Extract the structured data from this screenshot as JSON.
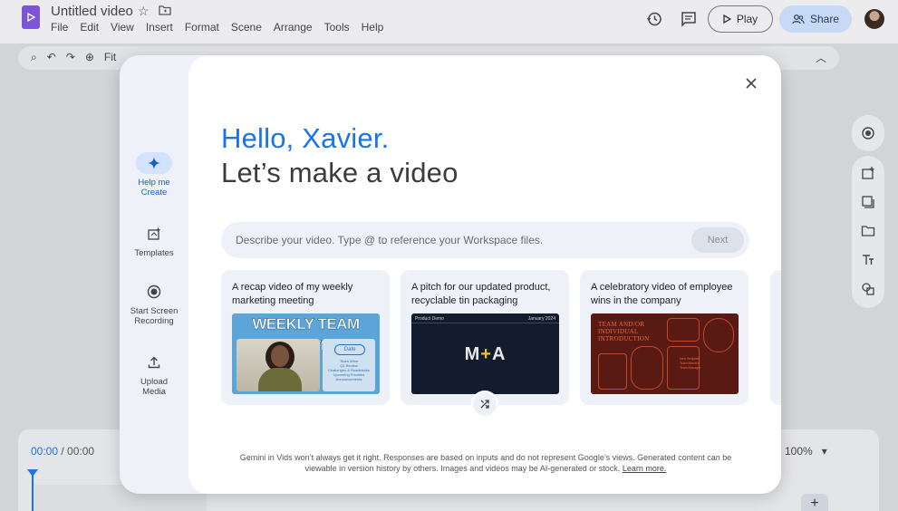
{
  "app": {
    "doc_title": "Untitled video",
    "menu": [
      "File",
      "Edit",
      "View",
      "Insert",
      "Format",
      "Scene",
      "Arrange",
      "Tools",
      "Help"
    ],
    "play_label": "Play",
    "share_label": "Share",
    "toolbar_fit_label": "Fit",
    "colors": {
      "brand_purple": "#7b55d6",
      "accent_blue": "#1a73e8",
      "share_bg": "#c7d9f4"
    }
  },
  "timeline": {
    "current_time": "00:00",
    "total_time": "/ 00:00",
    "zoom": "100%",
    "add_label": "+"
  },
  "modal": {
    "nav": [
      {
        "label_line1": "Help me",
        "label_line2": "Create",
        "icon": "sparkle-icon",
        "active": true
      },
      {
        "label_line1": "Templates",
        "label_line2": "",
        "icon": "templates-icon",
        "active": false
      },
      {
        "label_line1": "Start Screen",
        "label_line2": "Recording",
        "icon": "record-icon",
        "active": false
      },
      {
        "label_line1": "Upload",
        "label_line2": "Media",
        "icon": "upload-icon",
        "active": false
      }
    ],
    "greeting": "Hello, Xavier.",
    "headline": "Let’s make a video",
    "prompt_placeholder": "Describe your video. Type @ to reference your Workspace files.",
    "next_label": "Next",
    "cards": [
      {
        "text": "A recap video of my weekly marketing meeting",
        "thumb": {
          "banner": "WEEKLY TEAM UPDATES",
          "date": "Date",
          "agenda": [
            "Team Wins",
            "Q1 Review",
            "Challenges & Roadblocks",
            "Upcoming Priorities",
            "Announcements"
          ]
        }
      },
      {
        "text": "A pitch for our updated product, recyclable tin packaging",
        "thumb": {
          "label_left": "Product Demo",
          "label_right": "January 2024",
          "logo_left": "M",
          "logo_plus": "+",
          "logo_right": "A"
        }
      },
      {
        "text": "A celebratory video of employee wins in the company",
        "thumb": {
          "title": "TEAM AND/OR INDIVIDUAL INTRODUCTION",
          "small_lines": [
            "New Template",
            "Team Member",
            "Team Manager"
          ]
        }
      }
    ],
    "disclaimer": "Gemini in Vids won’t always get it right. Responses are based on inputs and do not represent Google’s views. Generated content can be viewable in version history by others. Images and videos may be AI-generated or stock.",
    "learn_more": "Learn more."
  }
}
